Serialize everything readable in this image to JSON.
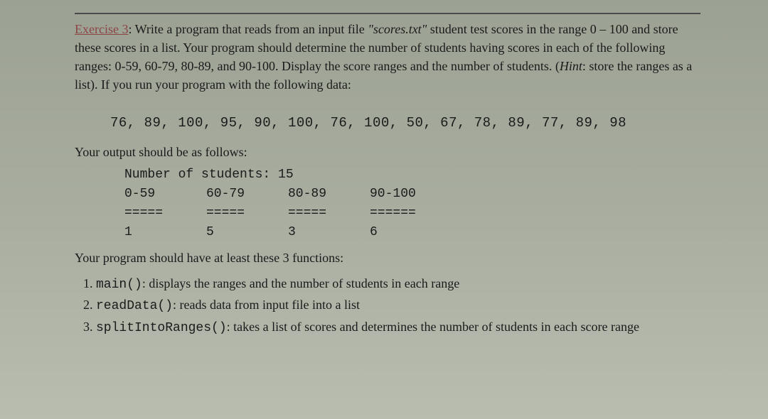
{
  "exercise": {
    "label": "Exercise 3",
    "prompt_part1": ": Write a program that reads from an input file ",
    "filename": "\"scores.txt\"",
    "prompt_part2": " student test scores in the range 0 – 100 and store these scores in a list. Your program should determine the number of students having scores in each of the following ranges: 0-59, 60-79, 80-89, and 90-100. Display the score ranges and the number of students. (",
    "hint_label": "Hint",
    "prompt_part3": ": store the ranges as a list). If you run your program with the following data:"
  },
  "data_values": "76, 89, 100, 95, 90, 100, 76, 100, 50, 67, 78, 89, 77, 89, 98",
  "output_intro": "Your output should be as follows:",
  "output": {
    "header": "Number of students: 15",
    "ranges": [
      "0-59",
      "60-79",
      "80-89",
      "90-100"
    ],
    "separators": [
      "=====",
      "=====",
      "=====",
      "======"
    ],
    "counts": [
      "1",
      "5",
      "3",
      "6"
    ]
  },
  "functions_intro": "Your program should have at least these 3 functions:",
  "functions": [
    {
      "name": "main()",
      "desc": ": displays the ranges and the number of students in each range"
    },
    {
      "name": "readData()",
      "desc": ": reads data from input file into a list"
    },
    {
      "name": "splitIntoRanges()",
      "desc": ": takes a list of scores and determines the number of students in each score range"
    }
  ]
}
